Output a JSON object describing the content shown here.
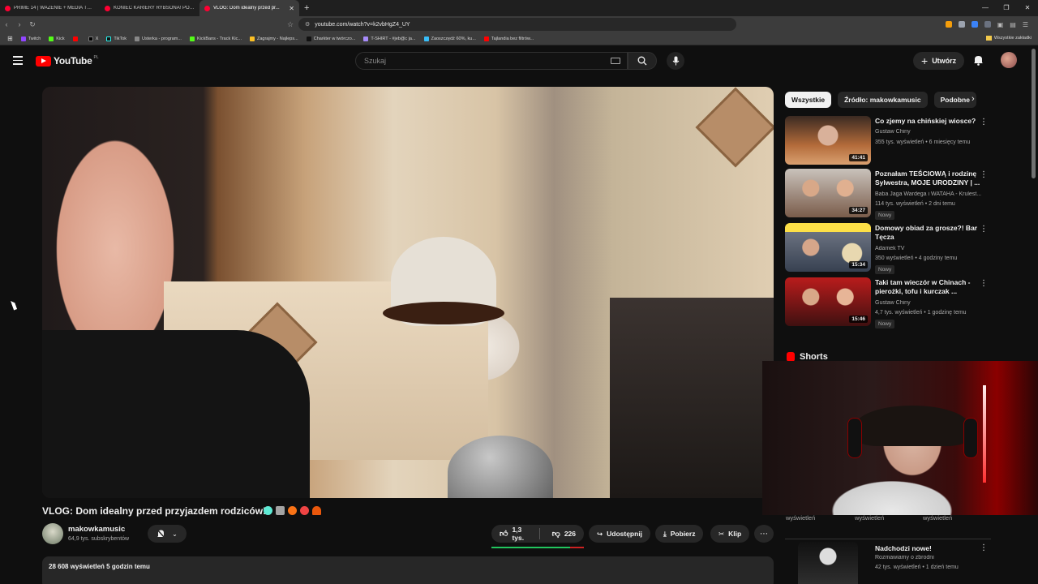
{
  "browser": {
    "tabs": [
      {
        "label": "PRIME 14 | WAŻENIE + MEDIA TRENI...",
        "active": false
      },
      {
        "label": "KONIEC KARIERY RYBSONA! PORÓŻ...",
        "active": false
      },
      {
        "label": "VLOG: Dom idealny przed pr...",
        "active": true
      }
    ],
    "new_tab": "+",
    "url": "youtube.com/watch?v=k2vbHgZ4_UY",
    "bookmarks": [
      "Twitch",
      "Kick",
      "",
      "X",
      "TikTok",
      "Usterka - program...",
      "KickBans - Track Kic...",
      "Zagrajmy - Najleps...",
      "Charkter w twórczo...",
      "T-SHIRT - #jeb@c ja...",
      "Zaoszczędź 60%, ku...",
      "Tajlandia bez filtrów..."
    ],
    "bookmarks_all": "Wszystkie zakładki"
  },
  "youtube": {
    "logo_text": "YouTube",
    "country": "PL",
    "search_placeholder": "Szukaj",
    "create_label": "Utwórz"
  },
  "video": {
    "title": "VLOG: Dom idealny przed przyjazdem rodziców!",
    "channel": "makowkamusic",
    "subscribers": "64,9 tys. subskrybentów",
    "likes": "1,3 tys.",
    "dislikes": "226",
    "like_ratio": 0.85,
    "share_label": "Udostępnij",
    "download_label": "Pobierz",
    "clip_label": "Klip",
    "description_meta": "28 608 wyświetleń  5 godzin temu"
  },
  "sidebar": {
    "chips": [
      "Wszystkie",
      "Źródło: makowkamusic",
      "Podobne"
    ],
    "recommendations": [
      {
        "title": "Co zjemy na chińskiej wiosce?",
        "channel": "Gustaw Chiny",
        "meta": "355 tys. wyświetleń • 6 miesięcy temu",
        "duration": "41:41",
        "new": ""
      },
      {
        "title": "Poznałam TEŚCIOWĄ i rodzinę Sylwestra, MOJE URODZINY | ...",
        "channel": "Baba Jaga Wardega i WATAHA - Krulest...",
        "meta": "114 tys. wyświetleń • 2 dni temu",
        "duration": "34:27",
        "new": "Nowy"
      },
      {
        "title": "Domowy obiad za grosze?! Bar Tęcza",
        "channel": "Adamek TV",
        "meta": "350 wyświetleń • 4 godziny temu",
        "duration": "15:34",
        "new": "Nowy"
      },
      {
        "title": "Taki tam wieczór w Chinach - pierożki, tofu i kurczak ...",
        "channel": "Gustaw Chiny",
        "meta": "4,7 tys. wyświetleń • 1 godzinę temu",
        "duration": "15:46",
        "new": "Nowy"
      }
    ],
    "shorts_label": "Shorts",
    "shorts_views": [
      "wyświetleń",
      "wyświetleń",
      "wyświetleń"
    ],
    "next_rec": {
      "title": "Nadchodzi nowe!",
      "channel": "Rozmawiamy o zbrodni",
      "meta": "42 tys. wyświetleń • 1 dzień temu"
    }
  },
  "colors": {
    "brand": "#ff0000",
    "bg": "#0f0f0f",
    "chip": "#272727"
  }
}
